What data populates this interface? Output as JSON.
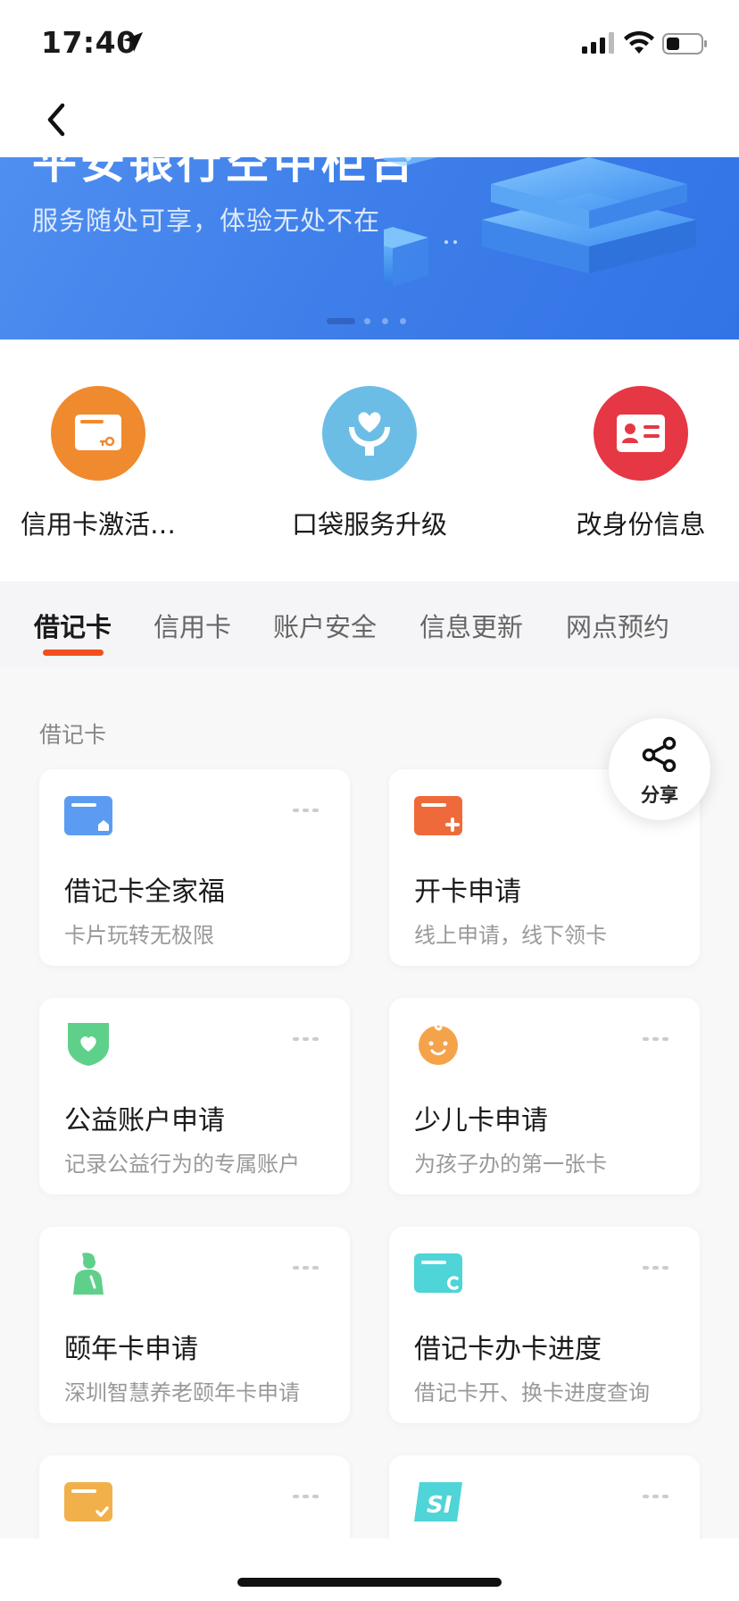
{
  "status_bar": {
    "time": "17:40",
    "icons": [
      "location-arrow-icon",
      "cellular-signal-icon",
      "wifi-icon",
      "battery-icon"
    ]
  },
  "nav": {
    "back_icon": "chevron-left-icon"
  },
  "banner": {
    "title": "平安银行空中柜台",
    "subtitle": "服务随处可享，体验无处不在",
    "page_count": 4,
    "active_page": 1
  },
  "quick_services": [
    {
      "label": "信用卡激活…",
      "icon": "card-key-icon",
      "color": "#f08a2e"
    },
    {
      "label": "口袋服务升级",
      "icon": "heart-hands-icon",
      "color": "#6cbde6"
    },
    {
      "label": "改身份信息",
      "icon": "id-card-icon",
      "color": "#e63744"
    }
  ],
  "tabs": [
    {
      "label": "借记卡",
      "active": true
    },
    {
      "label": "信用卡",
      "active": false
    },
    {
      "label": "账户安全",
      "active": false
    },
    {
      "label": "信息更新",
      "active": false
    },
    {
      "label": "网点预约",
      "active": false
    }
  ],
  "accent_color": "#f1501d",
  "section": {
    "title": "借记卡"
  },
  "share": {
    "label": "分享",
    "icon": "share-icon"
  },
  "cards": [
    {
      "title": "借记卡全家福",
      "desc": "卡片玩转无极限",
      "icon": "debit-card-home-icon",
      "color": "#5b9cf2"
    },
    {
      "title": "开卡申请",
      "desc": "线上申请，线下领卡",
      "icon": "card-plus-icon",
      "color": "#ef6a3a"
    },
    {
      "title": "公益账户申请",
      "desc": "记录公益行为的专属账户",
      "icon": "shield-heart-icon",
      "color": "#5fd08a"
    },
    {
      "title": "少儿卡申请",
      "desc": "为孩子办的第一张卡",
      "icon": "baby-face-icon",
      "color": "#f4a34a"
    },
    {
      "title": "颐年卡申请",
      "desc": "深圳智慧养老颐年卡申请",
      "icon": "elder-person-icon",
      "color": "#5fd08a"
    },
    {
      "title": "借记卡办卡进度",
      "desc": "借记卡开、换卡进度查询",
      "icon": "card-progress-icon",
      "color": "#4fd4d8"
    },
    {
      "title": "",
      "desc": "",
      "icon": "card-check-icon",
      "color": "#f2b04a"
    },
    {
      "title": "",
      "desc": "",
      "icon": "si-card-icon",
      "color": "#4fd4d8"
    }
  ]
}
